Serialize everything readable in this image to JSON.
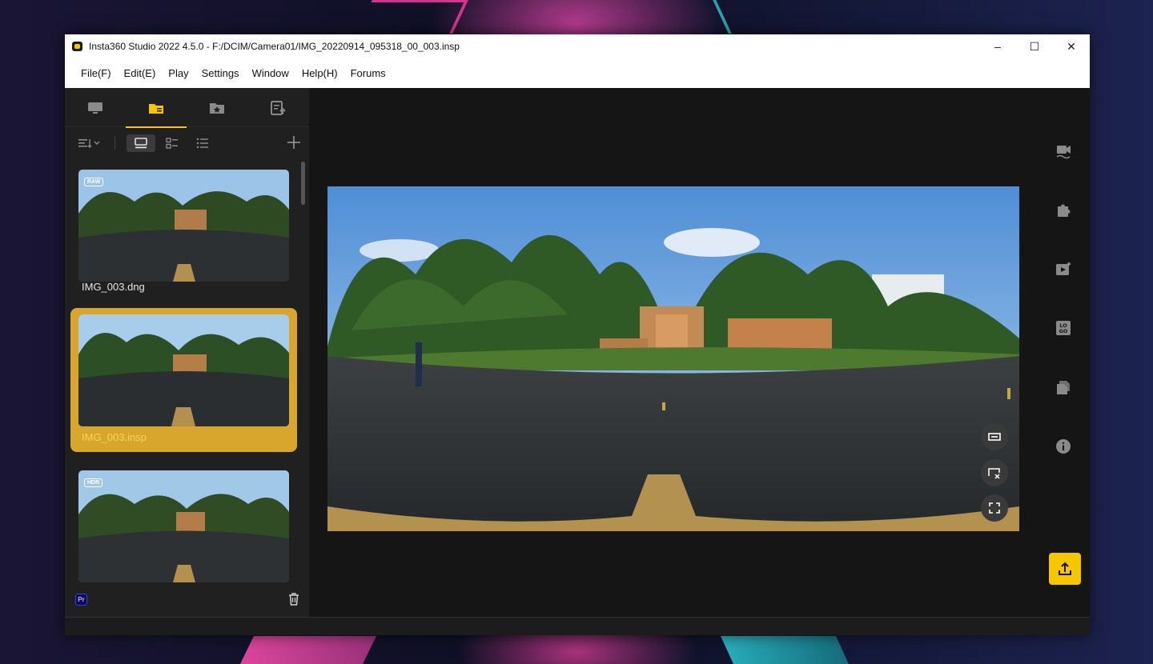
{
  "window": {
    "title": "Insta360 Studio 2022 4.5.0 - F:/DCIM/Camera01/IMG_20220914_095318_00_003.insp",
    "controls": {
      "minimize": "–",
      "maximize": "☐",
      "close": "✕"
    }
  },
  "menu": {
    "items": [
      "File(F)",
      "Edit(E)",
      "Play",
      "Settings",
      "Window",
      "Help(H)",
      "Forums"
    ]
  },
  "sidebar": {
    "tabs": [
      {
        "icon": "monitor-icon"
      },
      {
        "icon": "folder-icon",
        "active": true
      },
      {
        "icon": "favorites-folder-icon"
      },
      {
        "icon": "export-list-icon"
      }
    ],
    "files": [
      {
        "name": "IMG_003.dng",
        "badge": "RAW"
      },
      {
        "name": "IMG_003.insp",
        "badge": "",
        "selected": true
      },
      {
        "name": "",
        "badge": "HDR"
      }
    ],
    "bottom": {
      "pr_label": "Pr"
    }
  },
  "main": {
    "preview_controls": [
      "fit-width-icon",
      "crop-close-icon",
      "fullscreen-icon"
    ],
    "right_rail": [
      "video-edit-icon",
      "plugin-icon",
      "video-effects-icon",
      "logo-icon",
      "files-icon",
      "info-icon"
    ],
    "export_icon": "upload-icon"
  },
  "colors": {
    "accent": "#f6c600",
    "selected_card": "#d8a52d",
    "sidebar_bg": "#202020",
    "main_bg": "#151515"
  }
}
